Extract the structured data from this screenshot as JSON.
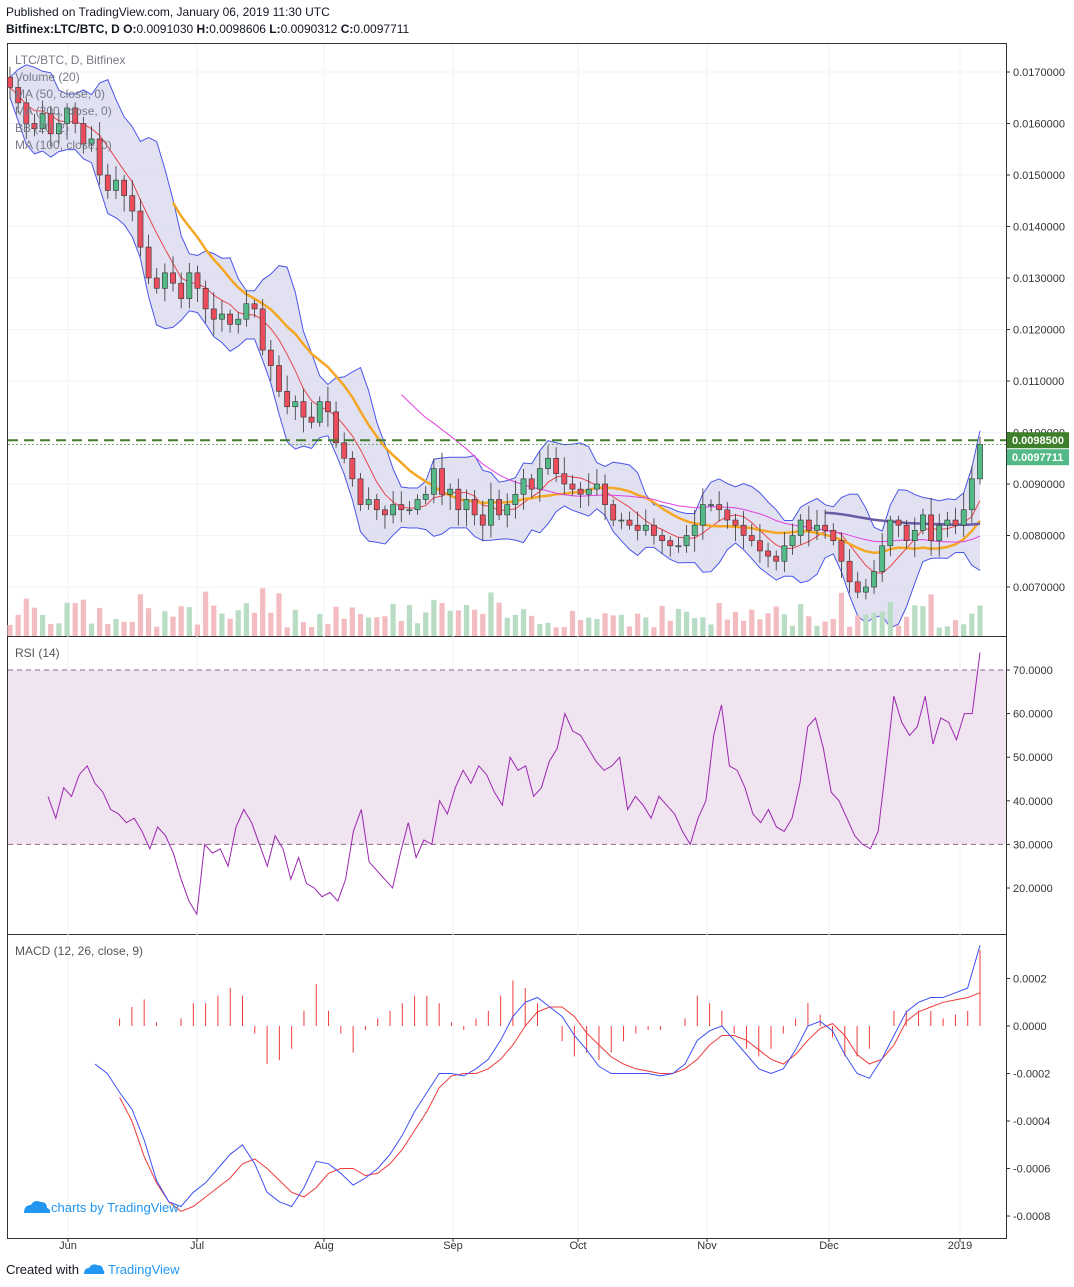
{
  "header": {
    "published": "Published on TradingView.com, January 06, 2019 11:30 UTC",
    "symbol_line": "Bitfinex:LTC/BTC, D",
    "o_label": "O:",
    "o": "0.0091030",
    "h_label": "H:",
    "h": "0.0098606",
    "l_label": "L:",
    "l": "0.0090312",
    "c_label": "C:",
    "c": "0.0097711"
  },
  "legend": [
    "LTC/BTC, D, Bitfinex",
    "Volume (20)",
    "MA (50, close, 0)",
    "MA (200, close, 0)",
    "BB (20, 2)",
    "MA (100, close, 0)"
  ],
  "watermark": "charts by TradingView",
  "footer": {
    "created_with": "Created with",
    "brand": "TradingView"
  },
  "colors": {
    "candle_up": "#53b987",
    "candle_down": "#eb4d5c",
    "bb": "#4a56e8",
    "bb_fill": "#d9daef",
    "ma20": "#e8474c",
    "ma50": "#f5a623",
    "ma100": "#e040e0",
    "ma200": "#6b5ca5",
    "hline": "#3d7f2a",
    "rsi": "#9c27b0",
    "rsi_band": "#f0e4f0",
    "macd": "#3f51f5",
    "signal": "#ef3b3b",
    "hist": "#ef3b3b"
  },
  "chart_data": [
    {
      "type": "candlestick",
      "title": "LTC/BTC, D, Bitfinex",
      "x_ticks": [
        "Jun",
        "Jul",
        "Aug",
        "Sep",
        "Oct",
        "Nov",
        "Dec",
        "2019"
      ],
      "y_ticks": [
        "0.0170000",
        "0.0160000",
        "0.0150000",
        "0.0140000",
        "0.0130000",
        "0.0120000",
        "0.0110000",
        "0.0100000",
        "0.0090000",
        "0.0080000",
        "0.0070000"
      ],
      "ylim": [
        0.0062,
        0.0173
      ],
      "last_price_label": "0.0097711",
      "horizontal_level_label": "0.0098500",
      "horizontal_level": 0.00985,
      "close_series": [
        0.0167,
        0.0164,
        0.016,
        0.0159,
        0.0162,
        0.0158,
        0.016,
        0.0163,
        0.016,
        0.0156,
        0.0157,
        0.015,
        0.0147,
        0.0149,
        0.0146,
        0.0143,
        0.0136,
        0.013,
        0.0128,
        0.0131,
        0.0129,
        0.0126,
        0.0131,
        0.0128,
        0.0124,
        0.0122,
        0.0123,
        0.0121,
        0.0122,
        0.0125,
        0.0124,
        0.0116,
        0.0113,
        0.0108,
        0.0105,
        0.0106,
        0.0103,
        0.0102,
        0.0106,
        0.0104,
        0.0098,
        0.0095,
        0.0091,
        0.0086,
        0.0087,
        0.0085,
        0.0084,
        0.0086,
        0.0085,
        0.0085,
        0.0087,
        0.0088,
        0.0093,
        0.0088,
        0.0089,
        0.0085,
        0.0087,
        0.0084,
        0.0082,
        0.0087,
        0.0084,
        0.0086,
        0.0088,
        0.0091,
        0.0089,
        0.0093,
        0.0095,
        0.0092,
        0.009,
        0.0089,
        0.0088,
        0.0089,
        0.009,
        0.0086,
        0.0083,
        0.0083,
        0.0082,
        0.0081,
        0.0082,
        0.008,
        0.0079,
        0.0078,
        0.0078,
        0.008,
        0.0082,
        0.0086,
        0.0086,
        0.0085,
        0.0083,
        0.0082,
        0.008,
        0.0079,
        0.0077,
        0.0076,
        0.0075,
        0.0078,
        0.008,
        0.0083,
        0.0081,
        0.0082,
        0.0081,
        0.0079,
        0.0075,
        0.0071,
        0.0069,
        0.007,
        0.0073,
        0.0078,
        0.0083,
        0.0082,
        0.0079,
        0.0081,
        0.0084,
        0.0079,
        0.0082,
        0.0083,
        0.0082,
        0.0085,
        0.0091,
        0.0097711
      ],
      "series": [
        {
          "name": "Volume (20)"
        },
        {
          "name": "MA (50, close, 0)"
        },
        {
          "name": "MA (200, close, 0)"
        },
        {
          "name": "BB (20, 2)"
        },
        {
          "name": "MA (100, close, 0)"
        }
      ]
    },
    {
      "type": "line",
      "title": "RSI (14)",
      "y_ticks": [
        "70.0000",
        "60.0000",
        "50.0000",
        "40.0000",
        "30.0000",
        "20.0000"
      ],
      "ylim": [
        10,
        76
      ],
      "band": [
        30,
        70
      ],
      "values": [
        41,
        36,
        43,
        41,
        46,
        48,
        44,
        42,
        38,
        37,
        35,
        36,
        33,
        29,
        34,
        32,
        28,
        22,
        17,
        14,
        30,
        28,
        29,
        25,
        34,
        38,
        35,
        30,
        25,
        32,
        29,
        22,
        27,
        21,
        20,
        18,
        19,
        17,
        22,
        33,
        38,
        26,
        24,
        22,
        20,
        28,
        35,
        27,
        31,
        30,
        40,
        37,
        43,
        47,
        44,
        48,
        46,
        42,
        39,
        50,
        47,
        48,
        41,
        43,
        49,
        52,
        60,
        56,
        55,
        52,
        49,
        47,
        48,
        50,
        38,
        41,
        39,
        36,
        41,
        39,
        37,
        33,
        30,
        36,
        40,
        55,
        62,
        48,
        47,
        43,
        37,
        35,
        38,
        34,
        33,
        36,
        44,
        57,
        59,
        52,
        42,
        40,
        36,
        32,
        30,
        29,
        33,
        48,
        64,
        58,
        55,
        57,
        64,
        53,
        59,
        58,
        54,
        60,
        60,
        74
      ]
    },
    {
      "type": "line",
      "title": "MACD (12, 26, close, 9)",
      "y_ticks": [
        "0.0002",
        "0.0000",
        "-0.0002",
        "-0.0004",
        "-0.0006",
        "-0.0008"
      ],
      "ylim": [
        -0.00088,
        0.00034
      ],
      "series": [
        {
          "name": "MACD",
          "values": [
            -0.00016,
            -0.0002,
            -0.00028,
            -0.00035,
            -0.00048,
            -0.00065,
            -0.00074,
            -0.00076,
            -0.0007,
            -0.00066,
            -0.0006,
            -0.00054,
            -0.0005,
            -0.00058,
            -0.0007,
            -0.00074,
            -0.00076,
            -0.00068,
            -0.00057,
            -0.00058,
            -0.00062,
            -0.00067,
            -0.00064,
            -0.0006,
            -0.00054,
            -0.00046,
            -0.00036,
            -0.00028,
            -0.0002,
            -0.0002,
            -0.00021,
            -0.00018,
            -0.00014,
            -6e-05,
            4e-05,
            0.0001,
            0.00012,
            8e-05,
            4e-05,
            -4e-05,
            -0.0001,
            -0.00017,
            -0.0002,
            -0.0002,
            -0.0002,
            -0.0002,
            -0.00021,
            -0.0002,
            -0.00016,
            -6e-05,
            -2e-05,
            0.0,
            -6e-05,
            -0.00012,
            -0.00018,
            -0.0002,
            -0.00018,
            -0.0001,
            0.0,
            2e-05,
            -2e-05,
            -0.00012,
            -0.0002,
            -0.00022,
            -0.00014,
            -4e-05,
            6e-05,
            0.0001,
            0.00012,
            0.00012,
            0.00014,
            0.00016,
            0.00034
          ]
        },
        {
          "name": "Signal",
          "values": [
            -0.00024,
            -0.00026,
            -0.0003,
            -0.0004,
            -0.00055,
            -0.00066,
            -0.00074,
            -0.00078,
            -0.00076,
            -0.00072,
            -0.00068,
            -0.00064,
            -0.00058,
            -0.00056,
            -0.0006,
            -0.00065,
            -0.0007,
            -0.00072,
            -0.00068,
            -0.00062,
            -0.0006,
            -0.0006,
            -0.00063,
            -0.00062,
            -0.00058,
            -0.00052,
            -0.00044,
            -0.00036,
            -0.00026,
            -0.00021,
            -0.0002,
            -0.0002,
            -0.00018,
            -0.00014,
            -8e-05,
            0.0,
            6e-05,
            8e-05,
            8e-05,
            4e-05,
            -3e-05,
            -8e-05,
            -0.00013,
            -0.00016,
            -0.00018,
            -0.00019,
            -0.0002,
            -0.0002,
            -0.00018,
            -0.00014,
            -8e-05,
            -4e-05,
            -4e-05,
            -6e-05,
            -0.0001,
            -0.00014,
            -0.00016,
            -0.00012,
            -6e-05,
            -1e-05,
            1e-05,
            -4e-05,
            -0.00012,
            -0.00016,
            -0.00014,
            -8e-05,
            2e-05,
            6e-05,
            8e-05,
            0.0001,
            0.00011,
            0.00012,
            0.00014
          ]
        }
      ]
    }
  ]
}
